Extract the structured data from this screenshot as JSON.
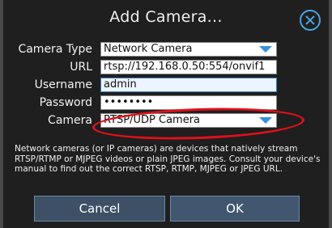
{
  "dialog": {
    "title": "Add Camera...",
    "close_icon": "close-circle-icon"
  },
  "form": {
    "camera_type": {
      "label": "Camera Type",
      "value": "Network Camera"
    },
    "url": {
      "label": "URL",
      "value": "rtsp://192.168.0.50:554/onvif1"
    },
    "username": {
      "label": "Username",
      "value": "admin"
    },
    "password": {
      "label": "Password",
      "value": "••••••••"
    },
    "camera": {
      "label": "Camera",
      "value": "RTSP/UDP Camera"
    }
  },
  "description": "Network cameras (or IP cameras) are devices that natively stream RTSP/RTMP or MJPEG videos or plain JPEG images. Consult your device's manual to find out the correct RTSP, RTMP, MJPEG or JPEG URL.",
  "buttons": {
    "cancel": "Cancel",
    "ok": "OK"
  },
  "colors": {
    "accent": "#4aa3df",
    "annotation": "#e0101a"
  }
}
